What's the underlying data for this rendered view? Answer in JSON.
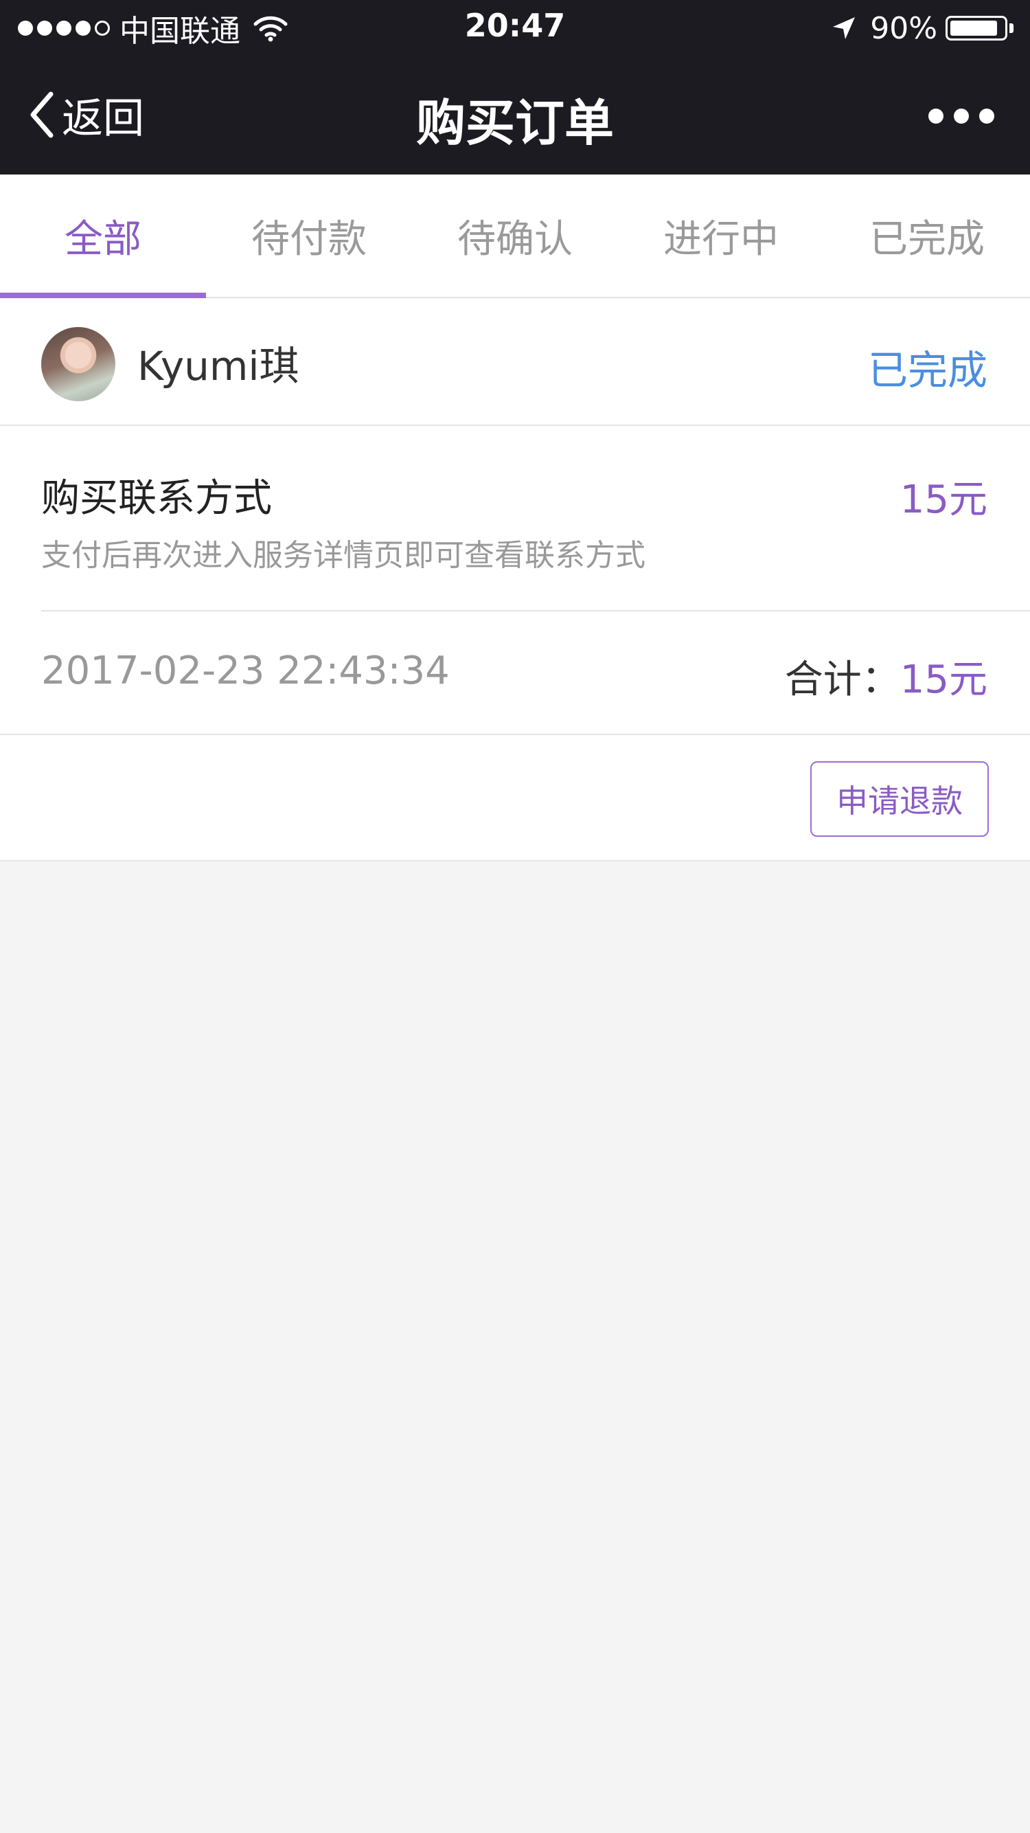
{
  "status_bar": {
    "carrier": "中国联通",
    "time": "20:47",
    "battery": "90%",
    "battery_level": 0.9,
    "signal_bars_filled": 4,
    "signal_bars_total": 5
  },
  "nav": {
    "back_label": "返回",
    "title": "购买订单",
    "more_icon": "more-dots-icon"
  },
  "tabs": [
    {
      "label": "全部",
      "active": true
    },
    {
      "label": "待付款",
      "active": false
    },
    {
      "label": "待确认",
      "active": false
    },
    {
      "label": "进行中",
      "active": false
    },
    {
      "label": "已完成",
      "active": false
    }
  ],
  "order": {
    "seller_name": "Kyumi琪",
    "status": "已完成",
    "item_title": "购买联系方式",
    "item_price": "15元",
    "item_desc": "支付后再次进入服务详情页即可查看联系方式",
    "created_at": "2017-02-23 22:43:34",
    "total_label": "合计：",
    "total_amount": "15元",
    "refund_label": "申请退款"
  },
  "colors": {
    "header_bg": "#1d1b22",
    "accent_purple": "#8a5bc4",
    "status_blue": "#4a8ee0",
    "page_bg": "#f4f4f4"
  }
}
